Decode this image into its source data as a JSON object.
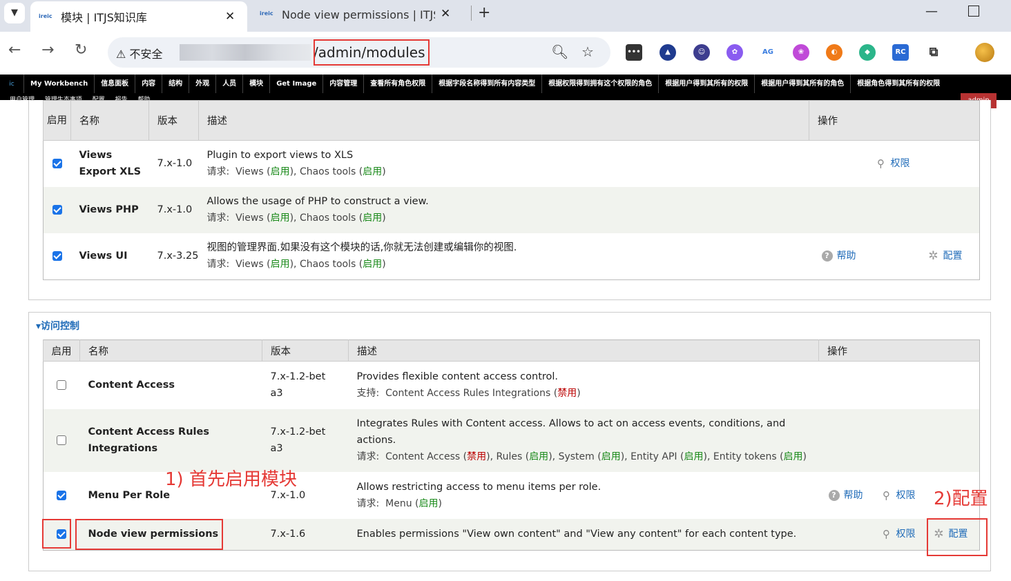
{
  "browser": {
    "active_tab": "模块 | ITJS知识库",
    "inactive_tab": "Node view permissions | ITJS知识库",
    "insecure_label": "不安全",
    "url_path": "/admin/modules",
    "favicon": "ireic"
  },
  "admin_menu": {
    "logo": "ic",
    "items": [
      "My Workbench",
      "信息面板",
      "内容",
      "结构",
      "外观",
      "人员",
      "模块",
      "Get Image",
      "内容管理",
      "查看所有角色权限",
      "根据字段名称得到所有内容类型",
      "根据权限得到拥有这个权限的角色",
      "根据用户得到其所有的权限",
      "根据用户得到其所有的角色",
      "根据角色得到其所有的权限"
    ],
    "row2": "用户管理 管理生态事项 配置 报告 帮助",
    "user": "admin"
  },
  "table1": {
    "headers": [
      "启用",
      "名称",
      "版本",
      "描述",
      "操作"
    ],
    "rows": [
      {
        "enabled": true,
        "name": "Views Export XLS",
        "version": "7.x-1.0",
        "desc": "Plugin to export views to XLS",
        "req_label": "请求:",
        "req": [
          {
            "n": "Views",
            "s": "启用"
          },
          {
            "n": "Chaos tools",
            "s": "启用"
          }
        ],
        "ops": {
          "perm": "权限"
        }
      },
      {
        "enabled": true,
        "name": "Views PHP",
        "version": "7.x-1.0",
        "desc": "Allows the usage of PHP to construct a view.",
        "req_label": "请求:",
        "req": [
          {
            "n": "Views",
            "s": "启用"
          },
          {
            "n": "Chaos tools",
            "s": "启用"
          }
        ],
        "ops": {}
      },
      {
        "enabled": true,
        "name": "Views UI",
        "version": "7.x-3.25",
        "desc": "视图的管理界面.如果没有这个模块的话,你就无法创建或编辑你的视图.",
        "req_label": "请求:",
        "req": [
          {
            "n": "Views",
            "s": "启用"
          },
          {
            "n": "Chaos tools",
            "s": "启用"
          }
        ],
        "ops": {
          "help": "帮助",
          "conf": "配置"
        }
      }
    ]
  },
  "section2": {
    "legend": "访问控制",
    "headers": [
      "启用",
      "名称",
      "版本",
      "描述",
      "操作"
    ],
    "rows": [
      {
        "enabled": false,
        "name": "Content Access",
        "version": "7.x-1.2-beta3",
        "desc": "Provides flexible content access control.",
        "req_label": "支持:",
        "req": [
          {
            "n": "Content Access Rules Integrations",
            "s": "禁用"
          }
        ],
        "ops": {}
      },
      {
        "enabled": false,
        "name": "Content Access Rules Integrations",
        "version": "7.x-1.2-beta3",
        "desc": "Integrates Rules with Content access. Allows to act on access events, conditions, and actions.",
        "req_label": "请求:",
        "req": [
          {
            "n": "Content Access",
            "s": "禁用"
          },
          {
            "n": "Rules",
            "s": "启用"
          },
          {
            "n": "System",
            "s": "启用"
          },
          {
            "n": "Entity API",
            "s": "启用"
          },
          {
            "n": "Entity tokens",
            "s": "启用"
          }
        ],
        "ops": {}
      },
      {
        "enabled": true,
        "name": "Menu Per Role",
        "version": "7.x-1.0",
        "desc": "Allows restricting access to menu items per role.",
        "req_label": "请求:",
        "req": [
          {
            "n": "Menu",
            "s": "启用"
          }
        ],
        "ops": {
          "help": "帮助",
          "perm": "权限"
        }
      },
      {
        "enabled": true,
        "name": "Node view permissions",
        "version": "7.x-1.6",
        "desc": "Enables permissions \"View own content\" and \"View any content\" for each content type.",
        "req_label": "",
        "req": [],
        "ops": {
          "perm": "权限",
          "conf": "配置"
        }
      }
    ]
  },
  "annotations": {
    "step1": "1) 首先启用模块",
    "step2": "2)配置"
  },
  "colors": {
    "accent": "#1f6bb8",
    "annotation": "#e53935",
    "enabled": "#1a8a1a",
    "disabled": "#b00000"
  }
}
